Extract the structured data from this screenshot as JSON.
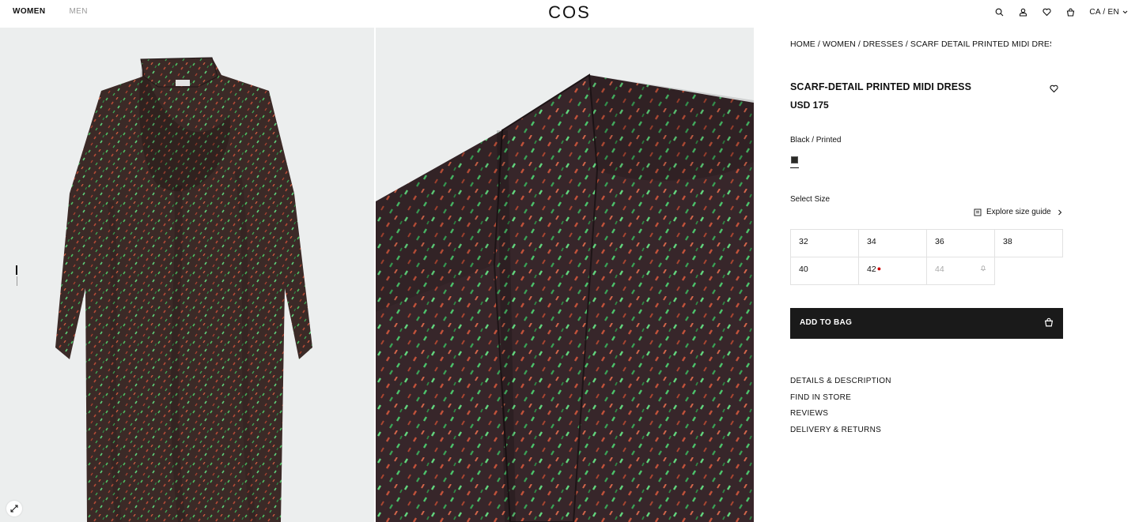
{
  "header": {
    "nav": [
      "WOMEN",
      "MEN"
    ],
    "logo": "COS",
    "locale": "CA / EN"
  },
  "colors": {
    "accent_dark": "#1a1a1a",
    "image_bg": "#eceeee",
    "low_stock_dot": "#cc0000"
  },
  "product": {
    "breadcrumb": "HOME / WOMEN / DRESSES / SCARF DETAIL PRINTED MIDI DRESS",
    "title": "SCARF-DETAIL PRINTED MIDI DRESS",
    "price": "USD 175",
    "color": "Black / Printed",
    "select_size_label": "Select Size",
    "size_guide_label": "Explore size guide",
    "sizes": [
      {
        "label": "32",
        "status": "available"
      },
      {
        "label": "34",
        "status": "available"
      },
      {
        "label": "36",
        "status": "available"
      },
      {
        "label": "38",
        "status": "available"
      },
      {
        "label": "40",
        "status": "available"
      },
      {
        "label": "42",
        "status": "low-stock"
      },
      {
        "label": "44",
        "status": "out-of-stock"
      }
    ],
    "add_to_bag": "ADD TO BAG"
  },
  "info_links": [
    "DETAILS & DESCRIPTION",
    "FIND IN STORE",
    "REVIEWS",
    "DELIVERY & RETURNS"
  ],
  "icons": [
    "search-icon",
    "account-icon",
    "heart-icon",
    "bag-icon",
    "chevron-down-icon",
    "expand-icon",
    "ruler-icon",
    "chevron-right-icon",
    "bell-icon"
  ]
}
